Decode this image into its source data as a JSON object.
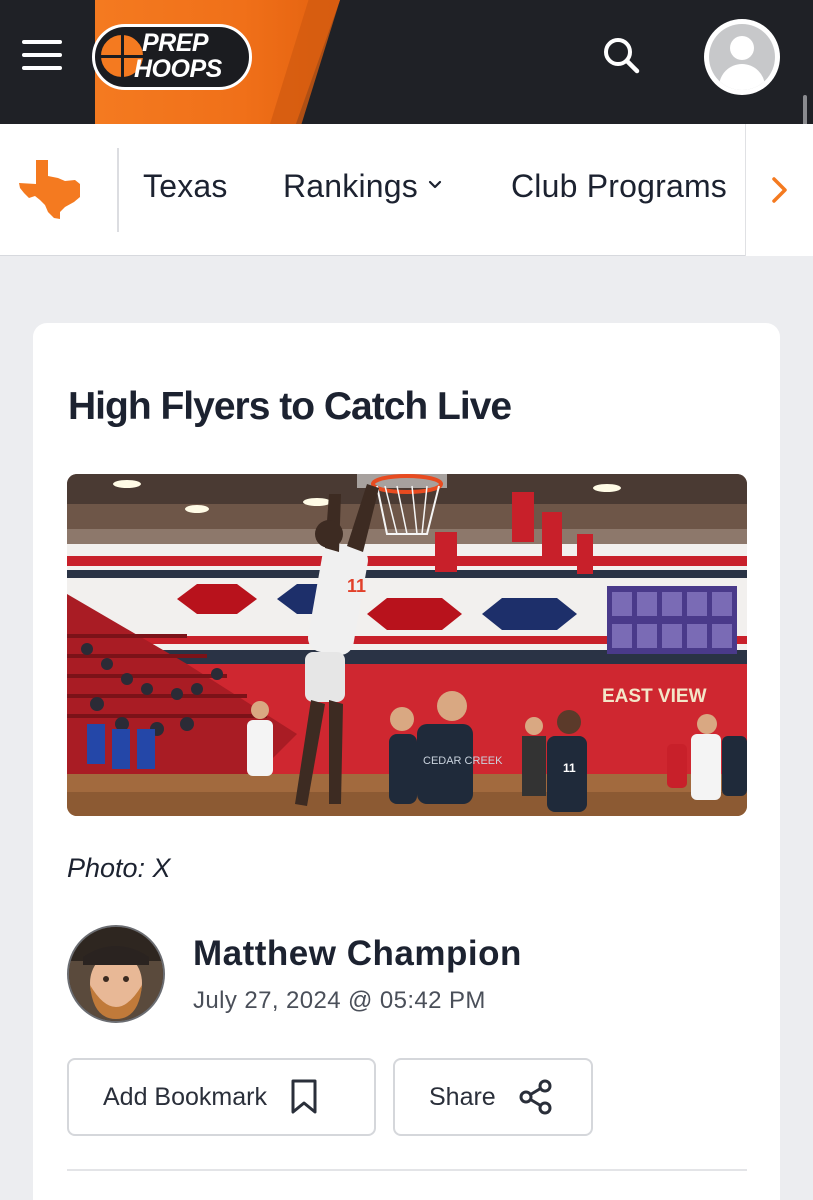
{
  "header": {
    "logo_line1": "PREP",
    "logo_line2": "HOOPS",
    "menu_icon": "hamburger-icon",
    "search_icon": "search-icon",
    "user_icon": "user-avatar-icon",
    "colors": {
      "bar": "#1f2126",
      "accent": "#f47a20"
    }
  },
  "subnav": {
    "state_icon": "texas-state-icon",
    "items": [
      {
        "label": "Texas"
      },
      {
        "label": "Rankings",
        "icon": "chevron-down-icon"
      },
      {
        "label": "Club Programs"
      }
    ],
    "more_icon": "chevron-right-icon"
  },
  "article": {
    "title": "High Flyers to Catch Live",
    "photo_caption": "Photo: X",
    "author": {
      "name": "Matthew Champion",
      "date": "July 27, 2024 @ 05:42 PM"
    },
    "actions": {
      "bookmark_label": "Add Bookmark",
      "bookmark_icon": "bookmark-icon",
      "share_label": "Share",
      "share_icon": "share-icon"
    },
    "photo_text": {
      "wall_text": "EAST VIEW"
    }
  }
}
